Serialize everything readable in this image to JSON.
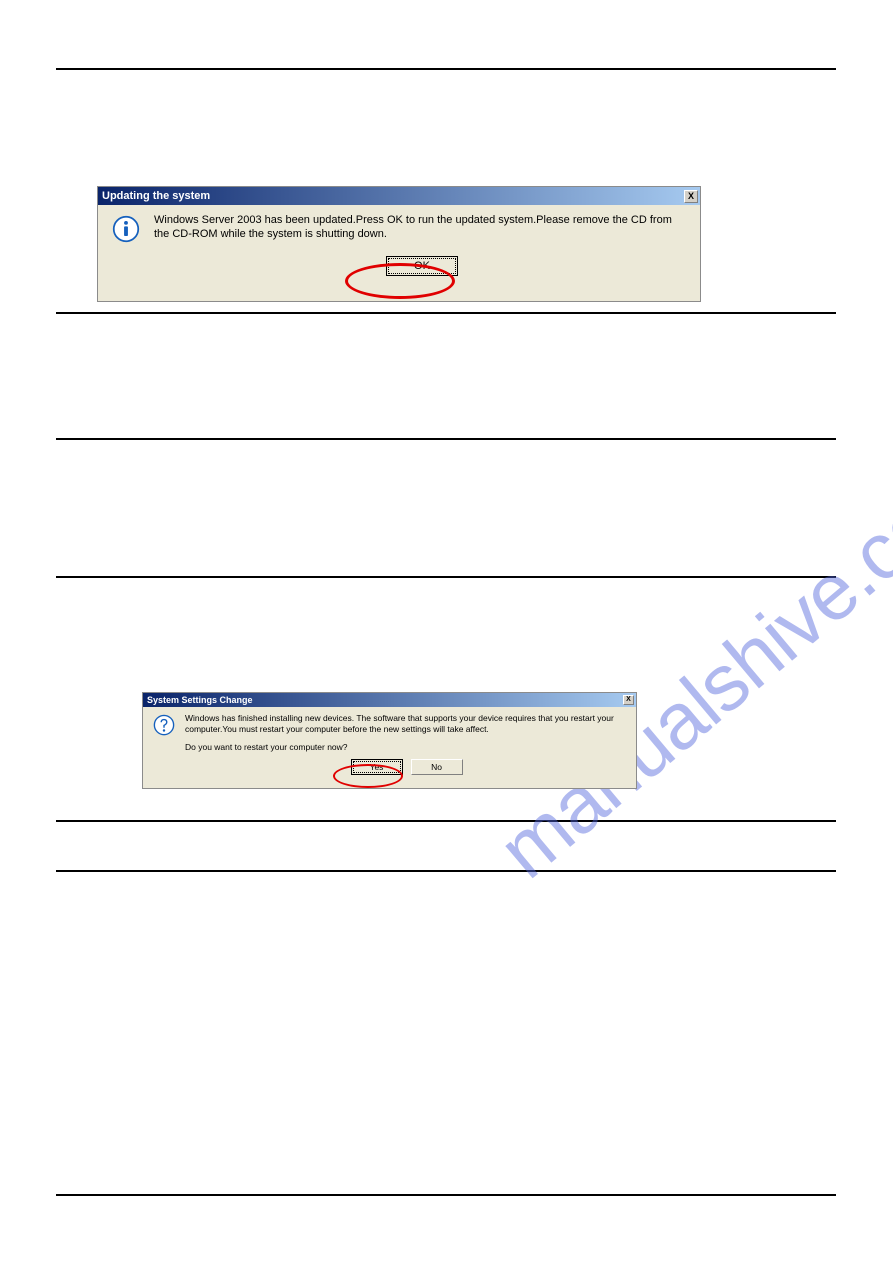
{
  "watermark": "manualshive.com",
  "dialog1": {
    "title": "Updating the system",
    "close_label": "X",
    "message": "Windows Server 2003 has been updated.Press OK to run the updated system.Please remove the CD from the CD-ROM while the system is shutting down.",
    "ok_label": "OK"
  },
  "dialog2": {
    "title": "System Settings Change",
    "close_label": "X",
    "message": "Windows has finished installing new devices. The software that supports your device requires that you restart your computer.You must restart your computer before the new settings will take affect.",
    "question": "Do you want to restart your computer now?",
    "yes_label": "Yes",
    "no_label": "No"
  }
}
